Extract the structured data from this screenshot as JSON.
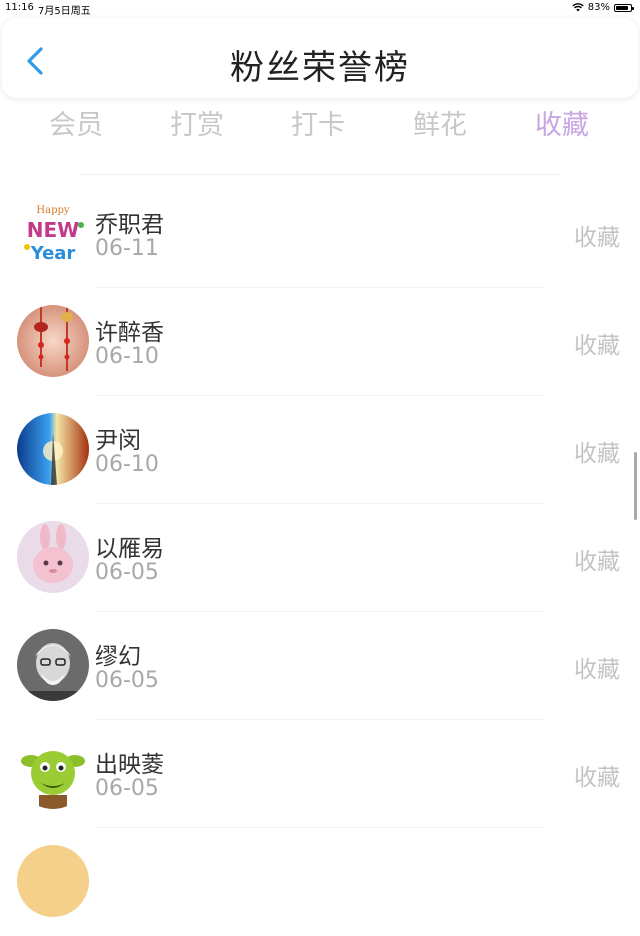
{
  "status_bar": {
    "time": "11:16",
    "date": "7月5日周五",
    "battery": "83%",
    "battery_level": 0.83
  },
  "header": {
    "title": "粉丝荣誉榜"
  },
  "tabs": [
    {
      "label": "会员"
    },
    {
      "label": "打赏"
    },
    {
      "label": "打卡"
    },
    {
      "label": "鲜花"
    },
    {
      "label": "收藏"
    }
  ],
  "active_tab": "收藏",
  "colors": {
    "accent": "#c7a6e3",
    "inactive_tab": "#c8c8c8",
    "muted": "#a8a8a8"
  },
  "list": [
    {
      "name": "乔职君",
      "date": "06-11",
      "type": "收藏",
      "avatar": "new-year-avatar"
    },
    {
      "name": "许醉香",
      "date": "06-10",
      "type": "收藏",
      "avatar": "lanterns-avatar"
    },
    {
      "name": "尹闵",
      "date": "06-10",
      "type": "收藏",
      "avatar": "fire-ice-avatar"
    },
    {
      "name": "以雁易",
      "date": "06-05",
      "type": "收藏",
      "avatar": "pink-bunny-avatar"
    },
    {
      "name": "缪幻",
      "date": "06-05",
      "type": "收藏",
      "avatar": "old-man-photo-avatar"
    },
    {
      "name": "出映菱",
      "date": "06-05",
      "type": "收藏",
      "avatar": "green-monster-avatar"
    }
  ]
}
